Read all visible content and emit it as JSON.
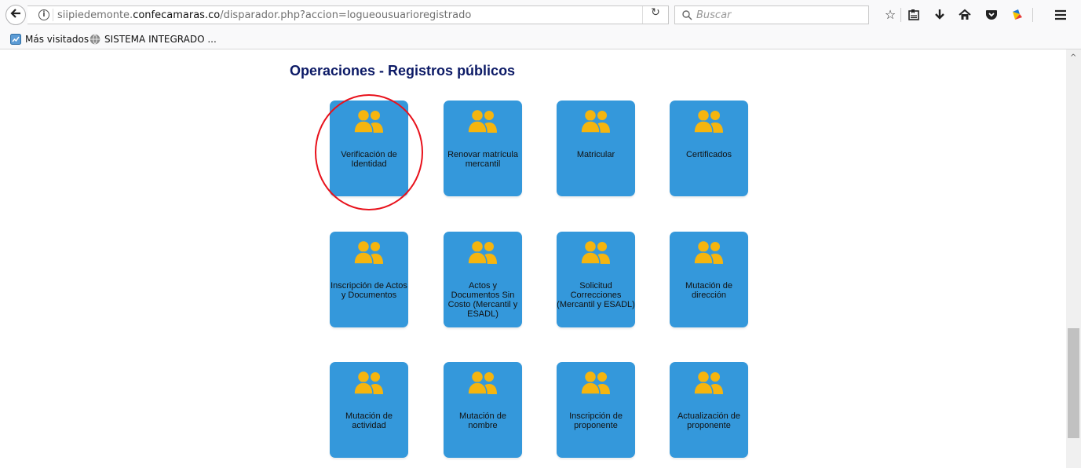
{
  "browser": {
    "url_prefix": "siipiedemonte.",
    "url_host": "confecamaras.co",
    "url_path": "/disparador.php?accion=logueousuarioregistrado",
    "search_placeholder": "Buscar",
    "bookmarks": [
      "Más visitados",
      "SISTEMA INTEGRADO ..."
    ],
    "toolbar_icons": [
      "back-arrow-icon",
      "info-icon",
      "reload-icon",
      "search-icon",
      "star-icon",
      "reading-list-icon",
      "download-icon",
      "home-icon",
      "pocket-icon",
      "extension-icon",
      "menu-icon"
    ]
  },
  "page": {
    "title": "Operaciones - Registros públicos",
    "tiles": [
      {
        "label": "Verificación de Identidad",
        "highlighted": true
      },
      {
        "label": "Renovar matrícula mercantil"
      },
      {
        "label": "Matricular"
      },
      {
        "label": "Certificados"
      },
      {
        "label": "Inscripción de Actos y Documentos"
      },
      {
        "label": "Actos y Documentos Sin Costo (Mercantil y ESADL)"
      },
      {
        "label": "Solicitud Correcciones (Mercantil y ESADL)"
      },
      {
        "label": "Mutación de dirección"
      },
      {
        "label": "Mutación de actividad"
      },
      {
        "label": "Mutación de nombre"
      },
      {
        "label": "Inscripción de proponente"
      },
      {
        "label": "Actualización de proponente"
      }
    ]
  },
  "colors": {
    "tile_bg": "#3498db",
    "icon_color": "#f5b50f",
    "title_color": "#0c1a66",
    "highlight_ring": "#e8121c"
  }
}
